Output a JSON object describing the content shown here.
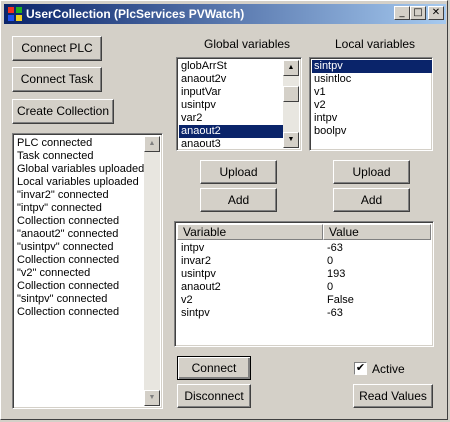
{
  "window": {
    "title": "UserCollection (PlcServices PVWatch)",
    "controls": {
      "minimize": "_",
      "maximize": "□",
      "close": "✕"
    }
  },
  "buttons": {
    "connect_plc": "Connect PLC",
    "connect_task": "Connect Task",
    "create_collection": "Create Collection",
    "upload_global": "Upload",
    "add_global": "Add",
    "upload_local": "Upload",
    "add_local": "Add",
    "connect": "Connect",
    "disconnect": "Disconnect",
    "read_values": "Read Values"
  },
  "log": {
    "lines": [
      "PLC connected",
      "Task connected",
      "Global variables uploaded",
      "Local variables uploaded",
      "\"invar2\" connected",
      "\"intpv\" connected",
      "Collection connected",
      "\"anaout2\" connected",
      "\"usintpv\" connected",
      "Collection connected",
      "\"v2\" connected",
      "Collection connected",
      "\"sintpv\" connected",
      "Collection connected"
    ]
  },
  "global_vars": {
    "label": "Global variables",
    "items": [
      "globArrSt",
      "anaout2v",
      "inputVar",
      "usintpv",
      "var2",
      "anaout2",
      "anaout3"
    ],
    "selected_index": 5
  },
  "local_vars": {
    "label": "Local variables",
    "items": [
      "sintpv",
      "usintloc",
      "v1",
      "v2",
      "intpv",
      "boolpv"
    ],
    "selected_index": 0
  },
  "table": {
    "columns": [
      "Variable",
      "Value"
    ],
    "rows": [
      [
        "intpv",
        "-63"
      ],
      [
        "invar2",
        "0"
      ],
      [
        "usintpv",
        "193"
      ],
      [
        "anaout2",
        "0"
      ],
      [
        "v2",
        "False"
      ],
      [
        "sintpv",
        "-63"
      ]
    ]
  },
  "active": {
    "label": "Active",
    "checked": true,
    "mark": "✔"
  },
  "colors": {
    "titlebar_start": "#0a246a",
    "titlebar_end": "#a6caf0",
    "selection": "#0a246a",
    "face": "#d4d0c8"
  },
  "icons": {
    "app": "app-icon",
    "scroll_up": "arrow-up-icon",
    "scroll_down": "arrow-down-icon",
    "check": "checkmark-icon"
  }
}
